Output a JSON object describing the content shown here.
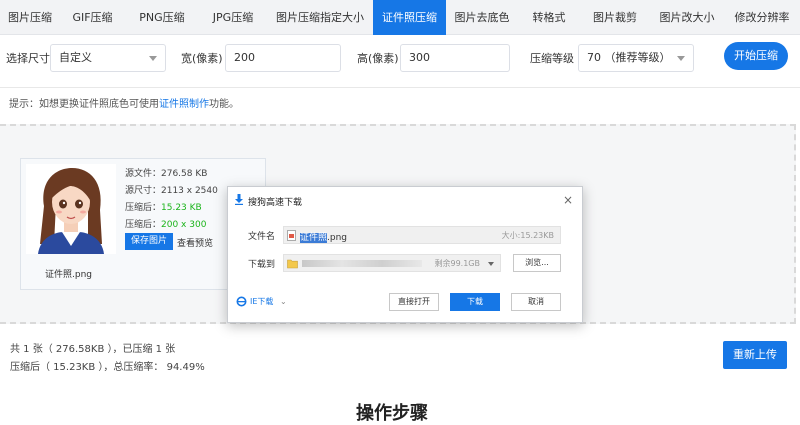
{
  "tabs": [
    {
      "label": "图片压缩"
    },
    {
      "label": "GIF压缩"
    },
    {
      "label": "PNG压缩"
    },
    {
      "label": "JPG压缩"
    },
    {
      "label": "图片压缩指定大小"
    },
    {
      "label": "证件照压缩",
      "active": true
    },
    {
      "label": "图片去底色"
    },
    {
      "label": "转格式"
    },
    {
      "label": "图片裁剪"
    },
    {
      "label": "图片改大小"
    },
    {
      "label": "修改分辨率"
    }
  ],
  "settings": {
    "size_label": "选择尺寸",
    "size_value": "自定义",
    "width_label": "宽(像素)",
    "width_value": "200",
    "height_label": "高(像素)",
    "height_value": "300",
    "level_label": "压缩等级",
    "level_value": "70 （推荐等级）",
    "start_button": "开始压缩"
  },
  "tip": {
    "prefix": "提示：如想更换证件照底色可使用",
    "link": "证件照制作",
    "suffix": "功能。"
  },
  "card": {
    "src_file": "源文件：276.58 KB",
    "src_size": "源尺寸：2113 x 2540",
    "after_label": "压缩后：",
    "after_value": "15.23 KB",
    "after_size_label": "压缩后：",
    "after_size_value": "200 x 300",
    "save_button": "保存图片",
    "preview_link": "查看预览",
    "filename": "证件照.png"
  },
  "summary": {
    "line1": "共 1 张（ 276.58KB ），已压缩 1 张",
    "line2": "压缩后（ 15.23KB ），总压缩率： 94.49%",
    "reupload_button": "重新上传",
    "heading_partial": "操作步骤"
  },
  "dialog": {
    "title": "搜狗高速下载",
    "close": "×",
    "filename_label": "文件名",
    "filename_selected": "证件照",
    "filename_ext": ".png",
    "size_label": "大小:15.23KB",
    "saveto_label": "下载到",
    "space_label": "剩余99.1GB",
    "browse_button": "浏览...",
    "ie_download": "IE下载",
    "open_button": "直接打开",
    "download_button": "下载",
    "cancel_button": "取消"
  },
  "colors": {
    "accent": "#1677e6",
    "green": "#1bb41b"
  }
}
